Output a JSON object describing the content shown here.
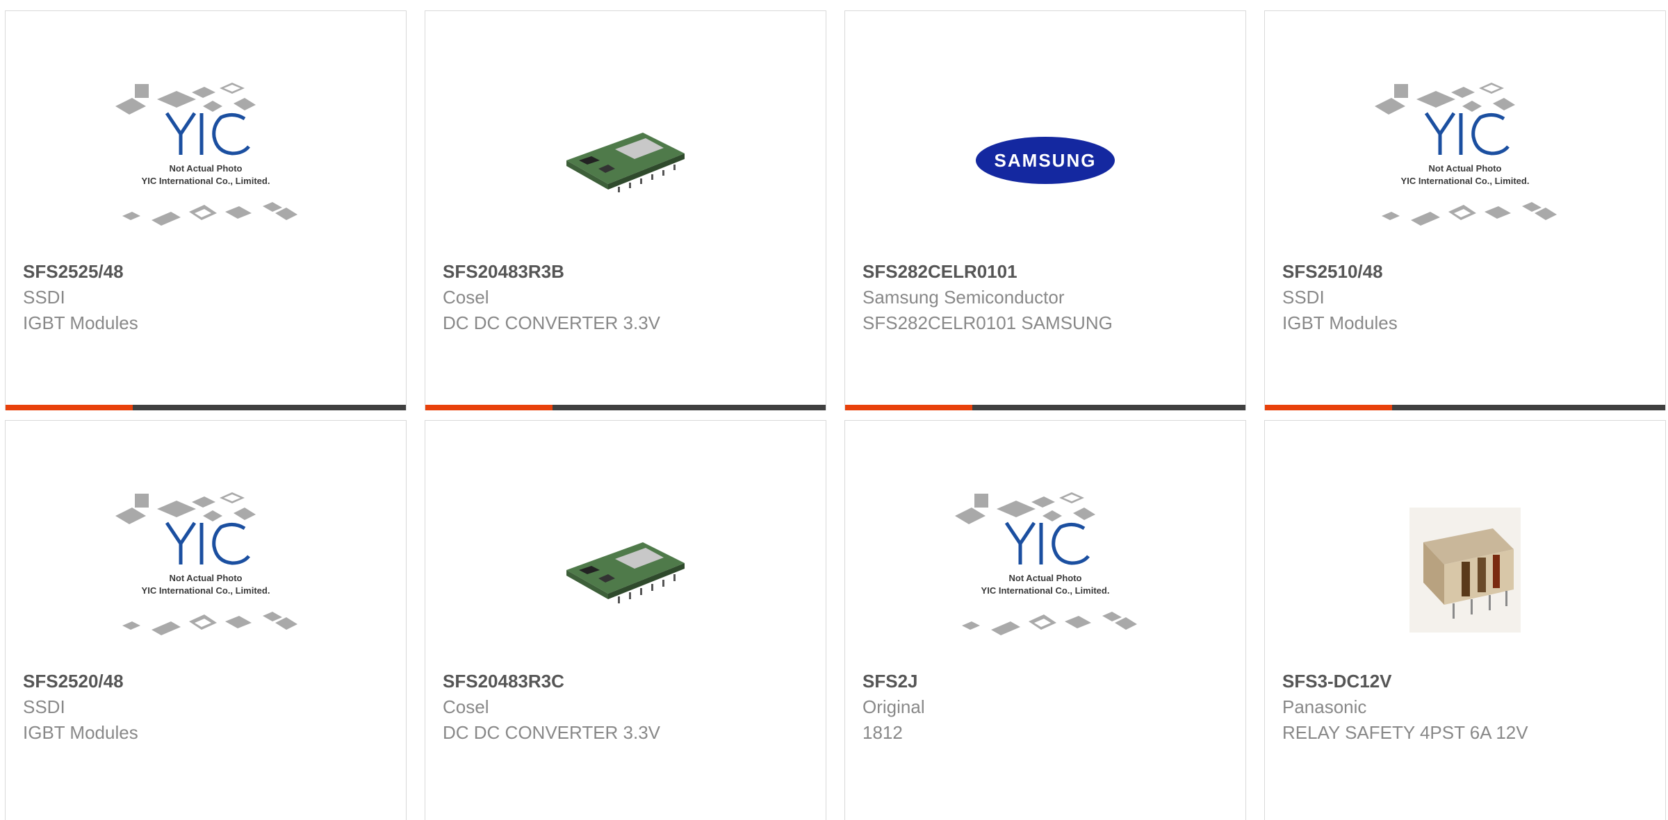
{
  "products": [
    {
      "part_number": "SFS2525/48",
      "manufacturer": "SSDI",
      "description": "IGBT Modules",
      "image": "yic-placeholder",
      "image_caption_1": "Not Actual Photo",
      "image_caption_2": "YIC International Co., Limited."
    },
    {
      "part_number": "SFS20483R3B",
      "manufacturer": "Cosel",
      "description": "DC DC CONVERTER 3.3V",
      "image": "pcb-module"
    },
    {
      "part_number": "SFS282CELR0101",
      "manufacturer": "Samsung Semiconductor",
      "description": "SFS282CELR0101 SAMSUNG",
      "image": "samsung-logo",
      "logo_text": "SAMSUNG"
    },
    {
      "part_number": "SFS2510/48",
      "manufacturer": "SSDI",
      "description": "IGBT Modules",
      "image": "yic-placeholder",
      "image_caption_1": "Not Actual Photo",
      "image_caption_2": "YIC International Co., Limited."
    },
    {
      "part_number": "SFS2520/48",
      "manufacturer": "SSDI",
      "description": "IGBT Modules",
      "image": "yic-placeholder",
      "image_caption_1": "Not Actual Photo",
      "image_caption_2": "YIC International Co., Limited."
    },
    {
      "part_number": "SFS20483R3C",
      "manufacturer": "Cosel",
      "description": "DC DC CONVERTER 3.3V",
      "image": "pcb-module"
    },
    {
      "part_number": "SFS2J",
      "manufacturer": "Original",
      "description": "1812",
      "image": "yic-placeholder",
      "image_caption_1": "Not Actual Photo",
      "image_caption_2": "YIC International Co., Limited."
    },
    {
      "part_number": "SFS3-DC12V",
      "manufacturer": "Panasonic",
      "description": "RELAY SAFETY 4PST 6A 12V",
      "image": "relay"
    }
  ],
  "colors": {
    "accent": "#e8410b",
    "bar": "#404040",
    "logo_blue": "#1b4fa0",
    "samsung_blue": "#1428a0"
  }
}
